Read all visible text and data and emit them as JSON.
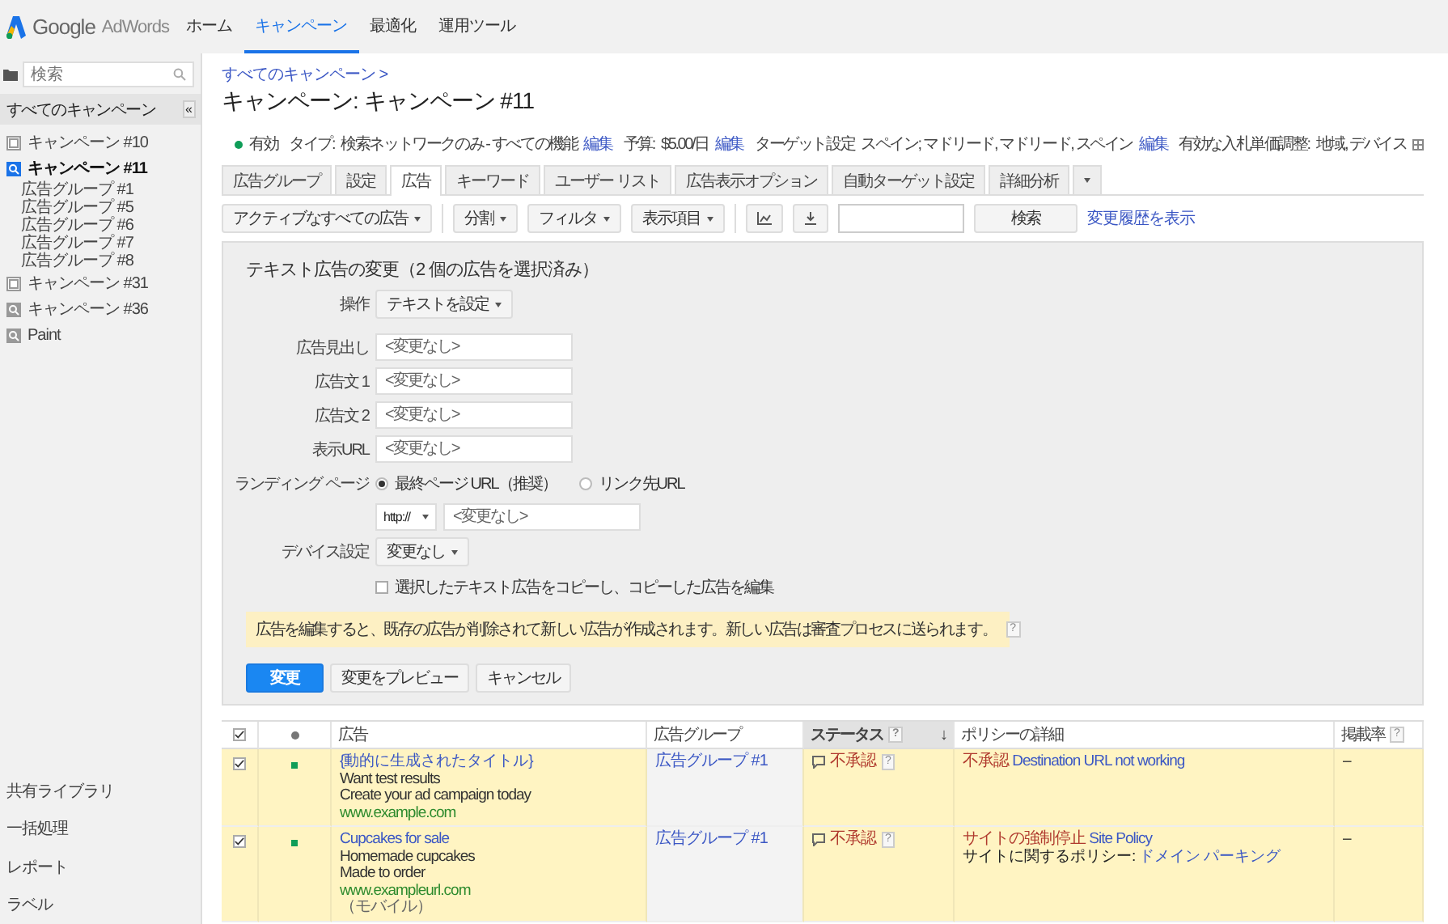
{
  "header": {
    "brand": "Google",
    "product": "AdWords",
    "nav": [
      {
        "label": "ホーム",
        "selected": false
      },
      {
        "label": "キャンペーン",
        "selected": true
      },
      {
        "label": "最適化",
        "selected": false
      },
      {
        "label": "運用ツール",
        "selected": false
      }
    ]
  },
  "sidebar": {
    "search": {
      "placeholder": "検索"
    },
    "all_campaigns": "すべてのキャンペーン",
    "collapse": "«",
    "tree": [
      {
        "label": "キャンペーン #10",
        "kind": "display",
        "selected": false
      },
      {
        "label": "キャンペーン #11",
        "kind": "search",
        "selected": true,
        "children": [
          {
            "label": "広告グループ #1",
            "selected": false
          },
          {
            "label": "広告グループ #5",
            "selected": false
          },
          {
            "label": "広告グループ #6",
            "selected": false
          },
          {
            "label": "広告グループ #7",
            "selected": false
          },
          {
            "label": "広告グループ #8",
            "selected": false
          }
        ]
      },
      {
        "label": "キャンペーン #31",
        "kind": "display",
        "selected": false
      },
      {
        "label": "キャンペーン #36",
        "kind": "search",
        "selected": false
      },
      {
        "label": "Paint",
        "kind": "search",
        "selected": false
      }
    ],
    "footer_links": [
      "共有ライブラリ",
      "一括処理",
      "レポート",
      "ラベル"
    ]
  },
  "main": {
    "breadcrumb": "すべてのキャンペーン >",
    "title": "キャンペーン: キャンペーン #11",
    "summary": {
      "status": "有効",
      "items": [
        {
          "label": "タイプ:",
          "value": "検索ネットワークのみ - すべての機能",
          "link": "編集"
        },
        {
          "label": "予算:",
          "value": "$5.00/日",
          "link": "編集"
        },
        {
          "label": "ターゲット設定",
          "value": "スペイン; マドリード, マドリード, スペイン",
          "link": "編集"
        },
        {
          "label": "有効な入札単価調整:",
          "value": "地域, デバイス"
        }
      ]
    },
    "tabs": [
      {
        "label": "広告グループ",
        "selected": false
      },
      {
        "label": "設定",
        "selected": false
      },
      {
        "label": "広告",
        "selected": true
      },
      {
        "label": "キーワード",
        "selected": false
      },
      {
        "label": "ユーザー リスト",
        "selected": false
      },
      {
        "label": "広告表示オプション",
        "selected": false
      },
      {
        "label": "自動ターゲット設定",
        "selected": false
      },
      {
        "label": "詳細分析",
        "selected": false
      }
    ],
    "toolbar": {
      "view_menu": "アクティブなすべての広告",
      "menus": [
        "分割",
        "フィルタ",
        "表示項目"
      ],
      "search_button": "検索",
      "history_link": "変更履歴を表示"
    },
    "edit_panel": {
      "title": "テキスト広告の変更（2 個の広告を選択済み）",
      "operation": {
        "label": "操作",
        "value": "テキストを設定"
      },
      "fields": [
        {
          "label": "広告見出し",
          "placeholder": "<変更なし>"
        },
        {
          "label": "広告文 1",
          "placeholder": "<変更なし>"
        },
        {
          "label": "広告文 2",
          "placeholder": "<変更なし>"
        },
        {
          "label": "表示URL",
          "placeholder": "<変更なし>"
        }
      ],
      "landing": {
        "label": "ランディング ページ",
        "options": [
          {
            "label": "最終ページ URL（推奨）",
            "selected": true
          },
          {
            "label": "リンク先URL",
            "selected": false
          }
        ],
        "protocol": "http://",
        "url_placeholder": "<変更なし>"
      },
      "device": {
        "label": "デバイス設定",
        "value": "変更なし"
      },
      "copy": {
        "label": "選択したテキスト広告をコピーし、コピーした広告を編集",
        "checked": false
      },
      "notice": {
        "text": "広告を編集すると、既存の広告が削除されて新しい広告が作成されます。新しい広告は審査プロセスに送られます。",
        "help": "?"
      },
      "buttons": [
        {
          "label": "変更",
          "kind": "primary"
        },
        {
          "label": "変更をプレビュー",
          "kind": "default"
        },
        {
          "label": "キャンセル",
          "kind": "default"
        }
      ]
    },
    "table": {
      "all_checked": true,
      "columns": [
        {
          "label": "広告",
          "sorted": false
        },
        {
          "label": "広告グループ",
          "sorted": false
        },
        {
          "label": "ステータス",
          "help": "?",
          "sort_mark": "↓",
          "sorted": true
        },
        {
          "label": "ポリシーの詳細",
          "sorted": false
        },
        {
          "label": "掲載率",
          "help": "?",
          "sorted": false
        }
      ],
      "rows": [
        {
          "selected": true,
          "color": "#0f9d58",
          "ad": {
            "headline": "{動的に生成されたタイトル}",
            "lines": [
              "Want test results",
              "Create your ad campaign today"
            ],
            "url": "www.example.com"
          },
          "ad_group": "広告グループ #1",
          "status": "不承認",
          "status_help": "?",
          "policy": [
            {
              "kind": "warning",
              "label": "不承認",
              "link": "Destination URL not working"
            }
          ],
          "rate": "–"
        },
        {
          "selected": true,
          "color": "#0f9d58",
          "ad": {
            "headline": "Cupcakes for sale",
            "lines": [
              "Homemade cupcakes",
              "Made to order"
            ],
            "url": "www.exampleurl.com",
            "note": "（モバイル）"
          },
          "ad_group": "広告グループ #1",
          "status": "不承認",
          "status_help": "?",
          "policy": [
            {
              "kind": "warning",
              "label": "サイトの強制停止",
              "link": "Site Policy"
            },
            {
              "kind": "note",
              "label": "サイトに関するポリシー:",
              "link": "ドメイン パーキング"
            }
          ],
          "rate": "–"
        }
      ]
    }
  }
}
